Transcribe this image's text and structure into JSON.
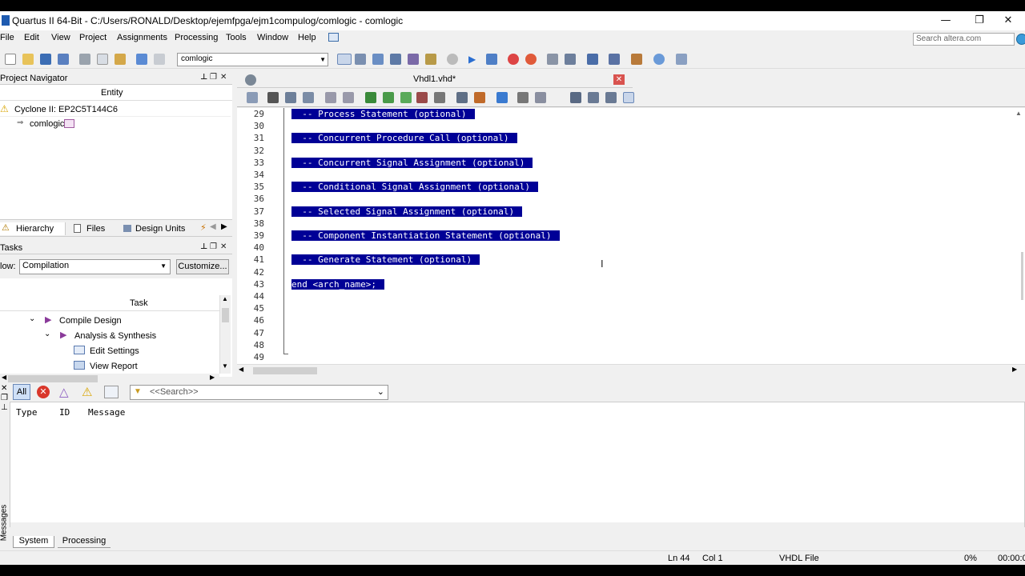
{
  "window": {
    "title": "Quartus II 64-Bit - C:/Users/RONALD/Desktop/ejemfpga/ejm1compulog/comlogic - comlogic",
    "minimize": "—",
    "maximize": "❐",
    "close": "✕"
  },
  "menu": {
    "items": [
      "File",
      "Edit",
      "View",
      "Project",
      "Assignments",
      "Processing",
      "Tools",
      "Window",
      "Help"
    ],
    "search_placeholder": "Search altera.com"
  },
  "toolbar": {
    "entity_value": "comlogic"
  },
  "project_navigator": {
    "title": "Project Navigator",
    "column_header": "Entity",
    "device": "Cyclone II: EP2C5T144C6",
    "top_entity": "comlogic",
    "tabs": [
      "Hierarchy",
      "Files",
      "Design Units"
    ]
  },
  "tasks": {
    "title": "Tasks",
    "flow_label": "low:",
    "flow_value": "Compilation",
    "customize_label": "Customize...",
    "column_header": "Task",
    "rows": [
      "Compile Design",
      "Analysis & Synthesis",
      "Edit Settings",
      "View Report"
    ]
  },
  "editor": {
    "tab_label": "Vhdl1.vhd*",
    "line_numbers": [
      "29",
      "30",
      "31",
      "32",
      "33",
      "34",
      "35",
      "36",
      "37",
      "38",
      "39",
      "40",
      "41",
      "42",
      "43",
      "44",
      "45",
      "46",
      "47",
      "48",
      "49"
    ],
    "code_lines": [
      "  -- Process Statement (optional)",
      "",
      "  -- Concurrent Procedure Call (optional)",
      "",
      "  -- Concurrent Signal Assignment (optional)",
      "",
      "  -- Conditional Signal Assignment (optional)",
      "",
      "  -- Selected Signal Assignment (optional)",
      "",
      "  -- Component Instantiation Statement (optional)",
      "",
      "  -- Generate Statement (optional)",
      "",
      "end <arch_name>;"
    ]
  },
  "messages": {
    "filter_all": "All",
    "search_placeholder": "<<Search>>",
    "columns": [
      "Type",
      "ID",
      "Message"
    ],
    "tabs": [
      "System",
      "Processing"
    ],
    "side_label": "Messages"
  },
  "status": {
    "line": "Ln 44",
    "col": "Col 1",
    "file_type": "VHDL File",
    "progress": "0%",
    "time": "00:00:0"
  },
  "colors": {
    "selection": "#000096",
    "accent": "#1e5bb0"
  }
}
